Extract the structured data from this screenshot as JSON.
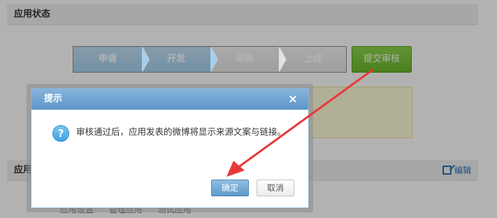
{
  "background": {
    "section_status_title": "应用状态",
    "section_app_title": "应用",
    "edit_label": "编辑",
    "steps": [
      {
        "label": "申请",
        "state": "done"
      },
      {
        "label": "开发",
        "state": "current"
      },
      {
        "label": "审核",
        "state": "pending"
      },
      {
        "label": "上线",
        "state": "pending"
      }
    ],
    "submit_review_label": "提交审核",
    "bottom_links": [
      "应用设置",
      "管理应用",
      "测试应用"
    ]
  },
  "dialog": {
    "title": "提示",
    "close_glyph": "×",
    "icon": "question-icon",
    "icon_glyph": "?",
    "message": "审核通过后，应用发表的微博将显示来源文案与链接。",
    "ok_label": "确定",
    "cancel_label": "取消"
  },
  "colors": {
    "dialog_title_bg": "#6fa4d2",
    "submit_green": "#7ac43a",
    "annotation_arrow": "#e8393a"
  }
}
